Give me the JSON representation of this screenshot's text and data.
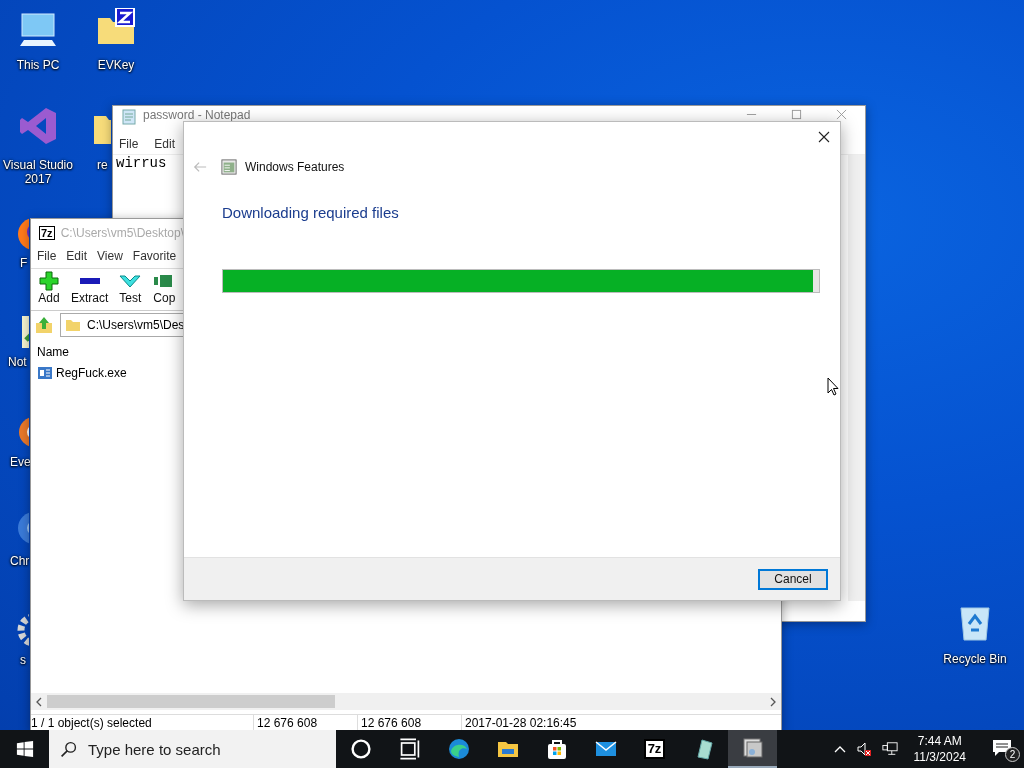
{
  "desktop_icons": [
    {
      "kind": "pc",
      "label": "This PC"
    },
    {
      "kind": "folder-z",
      "label": "EVKey"
    },
    {
      "kind": "vs",
      "label": "Visual Studio 2017"
    },
    {
      "kind": "folder",
      "label": "re"
    },
    {
      "kind": "firefox",
      "label": "F"
    },
    {
      "kind": "notepadpp",
      "label": "Not"
    },
    {
      "kind": "everything",
      "label": "Eve"
    },
    {
      "kind": "chrome",
      "label": "Chr"
    },
    {
      "kind": "gear",
      "label": "s"
    },
    {
      "kind": "recycle",
      "label": "Recycle Bin"
    }
  ],
  "notepad": {
    "title": "password - Notepad",
    "menu": [
      "File",
      "Edit"
    ],
    "text": "wirrus"
  },
  "sevenzip": {
    "icon_text": "7z",
    "title": "C:\\Users\\vm5\\Desktop\\",
    "menu": [
      "File",
      "Edit",
      "View",
      "Favorite"
    ],
    "tools": [
      {
        "kind": "add",
        "label": "Add"
      },
      {
        "kind": "extract",
        "label": "Extract"
      },
      {
        "kind": "test",
        "label": "Test"
      },
      {
        "kind": "copy",
        "label": "Cop"
      }
    ],
    "address": "C:\\Users\\vm5\\Des",
    "columns": [
      "Name"
    ],
    "rows": [
      {
        "name": "RegFuck.exe"
      }
    ],
    "status_bar": [
      "1 / 1 object(s) selected",
      "12 676 608",
      "12 676 608",
      "2017-01-28 02:16:45"
    ]
  },
  "dialog": {
    "title": "Windows Features",
    "heading": "Downloading required files",
    "progress": {
      "level": 0.99
    },
    "buttons": [
      "Cancel"
    ]
  },
  "taskbar": {
    "search": {
      "placeholder": "Type here to search"
    },
    "apps": [
      {
        "kind": "cortana",
        "active": false
      },
      {
        "kind": "taskview",
        "active": false
      },
      {
        "kind": "edge",
        "active": false
      },
      {
        "kind": "explorer",
        "active": false
      },
      {
        "kind": "store",
        "active": false
      },
      {
        "kind": "mail",
        "active": false
      },
      {
        "kind": "sevenzip",
        "text": "7z",
        "active": false
      },
      {
        "kind": "notepad",
        "active": false
      },
      {
        "kind": "features",
        "active": true
      }
    ],
    "time": "7:44 AM",
    "date": "11/3/2024",
    "notifications": "2"
  }
}
